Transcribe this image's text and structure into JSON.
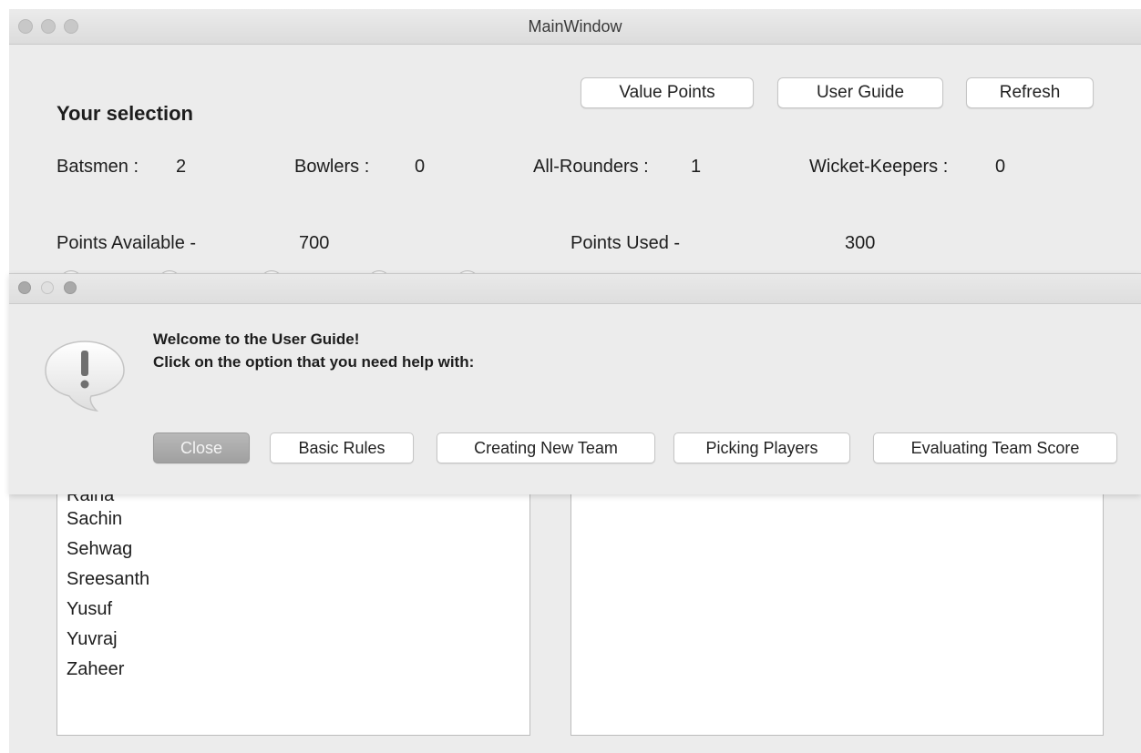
{
  "main_window": {
    "title": "MainWindow",
    "buttons": {
      "value_points": "Value Points",
      "user_guide": "User Guide",
      "refresh": "Refresh"
    },
    "heading": "Your selection",
    "counts": {
      "batsmen_label": "Batsmen :",
      "batsmen_value": "2",
      "bowlers_label": "Bowlers :",
      "bowlers_value": "0",
      "allrounders_label": "All-Rounders :",
      "allrounders_value": "1",
      "wicketkeepers_label": "Wicket-Keepers :",
      "wicketkeepers_value": "0"
    },
    "points": {
      "available_label": "Points Available -",
      "available_value": "700",
      "used_label": "Points Used -",
      "used_value": "300"
    }
  },
  "dialog": {
    "message_line1": "Welcome to the User Guide!",
    "message_line2": "Click on the option that you need help with:",
    "buttons": {
      "close": "Close",
      "basic_rules": "Basic Rules",
      "creating_new_team": "Creating New Team",
      "picking_players": "Picking Players",
      "evaluating_team_score": "Evaluating Team Score"
    },
    "icon": "alert-icon"
  },
  "players_list": {
    "partial_top": "Raina",
    "items": [
      "Sachin",
      "Sehwag",
      "Sreesanth",
      "Yusuf",
      "Yuvraj",
      "Zaheer"
    ]
  },
  "selected_list": {
    "items": []
  }
}
